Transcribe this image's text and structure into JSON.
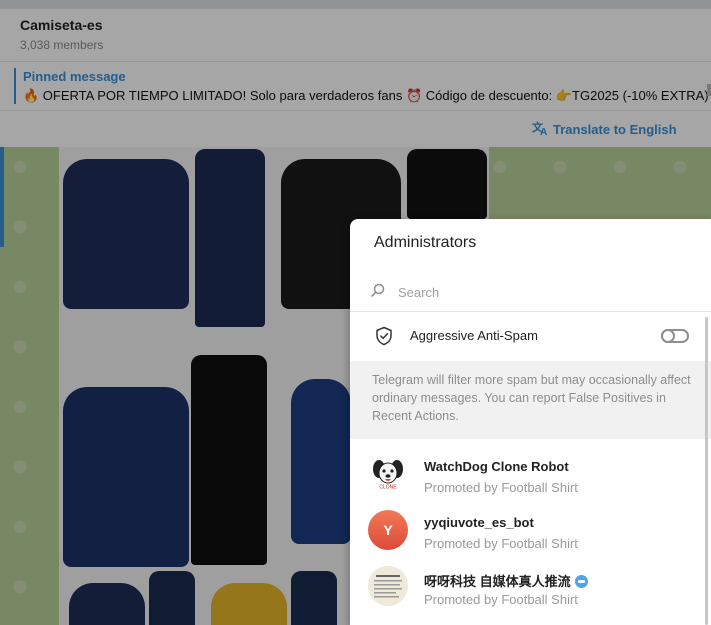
{
  "chat": {
    "title": "Camiseta-es",
    "members": "3,038 members",
    "pinned_label": "Pinned message",
    "pinned_text": "🔥 OFERTA POR TIEMPO LIMITADO! Solo para verdaderos fans ⏰ Código de descuento: 👉TG2025 (-10% EXTRA)",
    "translate_label": "Translate to English"
  },
  "modal": {
    "title": "Administrators",
    "search_placeholder": "Search",
    "spam_label": "Aggressive Anti-Spam",
    "spam_enabled": false,
    "info": "Telegram will filter more spam but may occasionally affect ordinary messages. You can report False Positives in Recent Actions."
  },
  "admins": [
    {
      "name": "WatchDog Clone Robot",
      "role": "Promoted by Football Shirt",
      "avatar": "dog-avatar"
    },
    {
      "name": "yyqiuvote_es_bot",
      "role": "Promoted by Football Shirt",
      "avatar_letter": "Y",
      "avatar_color": "#e0553a"
    },
    {
      "name": "呀呀科技 自媒体真人推流",
      "role": "Promoted by Football Shirt",
      "avatar": "doc-avatar"
    }
  ],
  "colors": {
    "accent": "#3a8fd6",
    "chat_background": "#b8cf9a"
  }
}
